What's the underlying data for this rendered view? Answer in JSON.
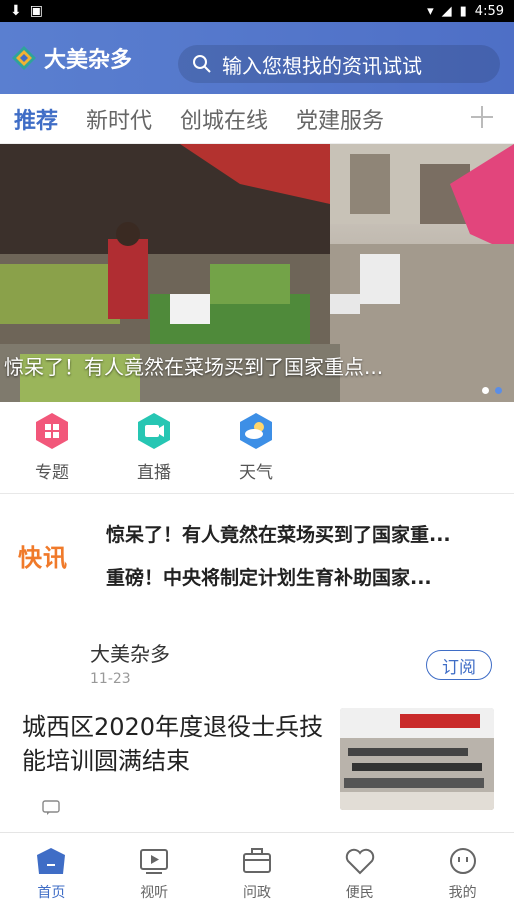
{
  "status_bar": {
    "time": "4:59"
  },
  "header": {
    "app_name": "大美杂多",
    "search_placeholder": "输入您想找的资讯试试"
  },
  "tabs": [
    {
      "label": "推荐",
      "active": true
    },
    {
      "label": "新时代",
      "active": false
    },
    {
      "label": "创城在线",
      "active": false
    },
    {
      "label": "党建服务",
      "active": false
    }
  ],
  "banner": {
    "caption": "惊呆了！有人竟然在菜场买到了国家重点..."
  },
  "quick": [
    {
      "label": "专题",
      "icon": "grid-icon"
    },
    {
      "label": "直播",
      "icon": "video-camera-icon"
    },
    {
      "label": "天气",
      "icon": "weather-icon"
    }
  ],
  "kuaixun": {
    "logo": "快讯",
    "items": [
      "惊呆了！有人竟然在菜场买到了国家重...",
      "重磅！中央将制定计划生育补助国家..."
    ]
  },
  "news": {
    "source": "大美杂多",
    "date": "11-23",
    "subscribe_label": "订阅",
    "title": "城西区2020年度退役士兵技能培训圆满结束"
  },
  "tabbar": [
    {
      "label": "首页",
      "active": true
    },
    {
      "label": "视听",
      "active": false
    },
    {
      "label": "问政",
      "active": false
    },
    {
      "label": "便民",
      "active": false
    },
    {
      "label": "我的",
      "active": false
    }
  ],
  "colors": {
    "brand": "#3f6dc6",
    "header": "#5a7fd0",
    "kuaixun": "#f07a2a"
  }
}
